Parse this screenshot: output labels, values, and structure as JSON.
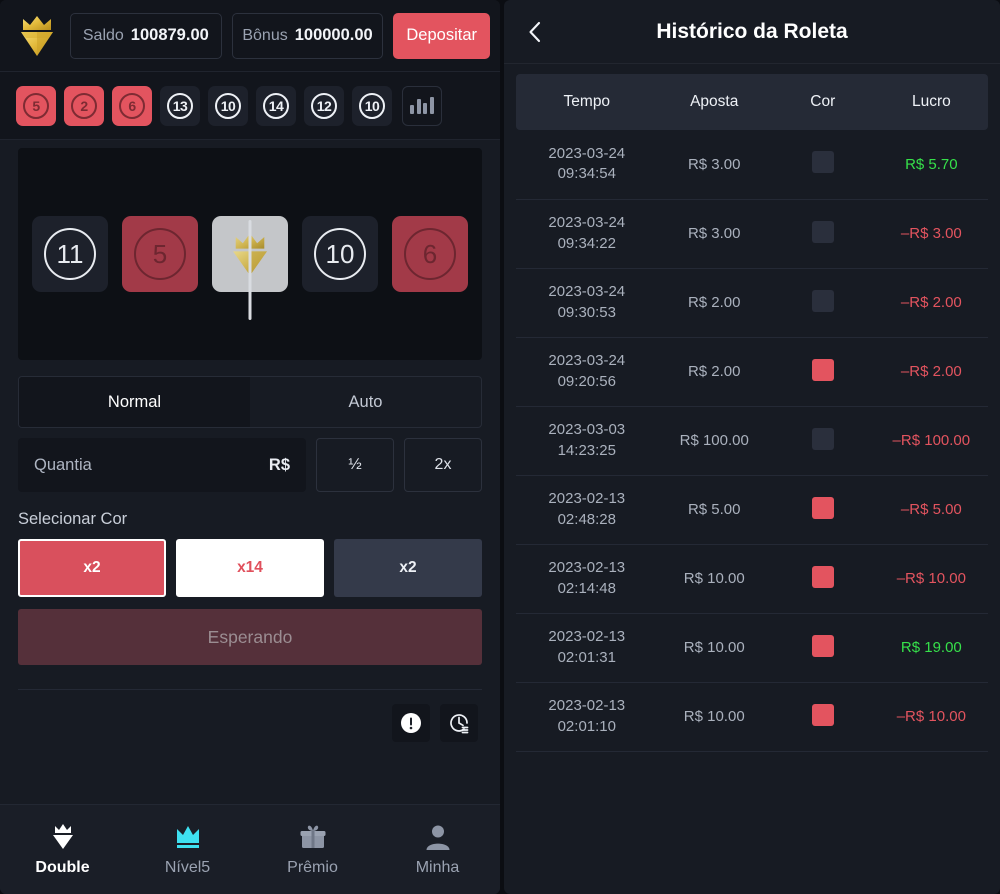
{
  "left": {
    "header": {
      "logo_icon": "crown-diamond-logo",
      "balance_label": "Saldo",
      "balance_value": "100879.00",
      "bonus_label": "Bônus",
      "bonus_value": "100000.00",
      "deposit_label": "Depositar"
    },
    "recent_results": [
      {
        "value": "5",
        "color": "red"
      },
      {
        "value": "2",
        "color": "red"
      },
      {
        "value": "6",
        "color": "red"
      },
      {
        "value": "13",
        "color": "black"
      },
      {
        "value": "10",
        "color": "black"
      },
      {
        "value": "14",
        "color": "black"
      },
      {
        "value": "12",
        "color": "black"
      },
      {
        "value": "10",
        "color": "black"
      }
    ],
    "stats_icon": "bar-chart-icon",
    "reel": [
      {
        "value": "11",
        "color": "black"
      },
      {
        "value": "5",
        "color": "red"
      },
      {
        "value": "",
        "color": "white",
        "icon": "crown-diamond-icon"
      },
      {
        "value": "10",
        "color": "black"
      },
      {
        "value": "6",
        "color": "red"
      }
    ],
    "modes": [
      {
        "label": "Normal",
        "active": true
      },
      {
        "label": "Auto",
        "active": false
      }
    ],
    "amount": {
      "placeholder": "Quantia",
      "value": "",
      "currency": "R$",
      "half_label": "½",
      "double_label": "2x"
    },
    "select_color_label": "Selecionar Cor",
    "color_options": [
      {
        "label": "x2",
        "style": "red",
        "selected": true
      },
      {
        "label": "x14",
        "style": "white",
        "selected": false
      },
      {
        "label": "x2",
        "style": "black",
        "selected": false
      }
    ],
    "action_label": "Esperando",
    "footer_icons": [
      {
        "name": "info-alert-icon"
      },
      {
        "name": "history-clock-icon"
      }
    ],
    "nav": [
      {
        "label": "Double",
        "icon": "crown-diamond-icon",
        "active": true
      },
      {
        "label": "Nível5",
        "icon": "crown-icon",
        "active": false
      },
      {
        "label": "Prêmio",
        "icon": "gift-icon",
        "active": false
      },
      {
        "label": "Minha",
        "icon": "user-icon",
        "active": false
      }
    ]
  },
  "right": {
    "back_icon": "chevron-left-icon",
    "title": "Histórico da Roleta",
    "columns": [
      "Tempo",
      "Aposta",
      "Cor",
      "Lucro"
    ],
    "rows": [
      {
        "time": "2023-03-24 09:34:54",
        "bet": "R$ 3.00",
        "color": "black",
        "profit": "R$ 5.70",
        "profit_sign": "pos"
      },
      {
        "time": "2023-03-24 09:34:22",
        "bet": "R$ 3.00",
        "color": "black",
        "profit": "–R$ 3.00",
        "profit_sign": "neg"
      },
      {
        "time": "2023-03-24 09:30:53",
        "bet": "R$ 2.00",
        "color": "black",
        "profit": "–R$ 2.00",
        "profit_sign": "neg"
      },
      {
        "time": "2023-03-24 09:20:56",
        "bet": "R$ 2.00",
        "color": "red",
        "profit": "–R$ 2.00",
        "profit_sign": "neg"
      },
      {
        "time": "2023-03-03 14:23:25",
        "bet": "R$ 100.00",
        "color": "black",
        "profit": "–R$ 100.00",
        "profit_sign": "neg"
      },
      {
        "time": "2023-02-13 02:48:28",
        "bet": "R$ 5.00",
        "color": "red",
        "profit": "–R$ 5.00",
        "profit_sign": "neg"
      },
      {
        "time": "2023-02-13 02:14:48",
        "bet": "R$ 10.00",
        "color": "red",
        "profit": "–R$ 10.00",
        "profit_sign": "neg"
      },
      {
        "time": "2023-02-13 02:01:31",
        "bet": "R$ 10.00",
        "color": "red",
        "profit": "R$ 19.00",
        "profit_sign": "pos"
      },
      {
        "time": "2023-02-13 02:01:10",
        "bet": "R$ 10.00",
        "color": "red",
        "profit": "–R$ 10.00",
        "profit_sign": "neg"
      }
    ]
  },
  "colors": {
    "accent_red": "#e3545f",
    "profit_green": "#36e04a",
    "panel_bg": "#171b23",
    "nav_active_cyan": "#3ee0f0"
  }
}
